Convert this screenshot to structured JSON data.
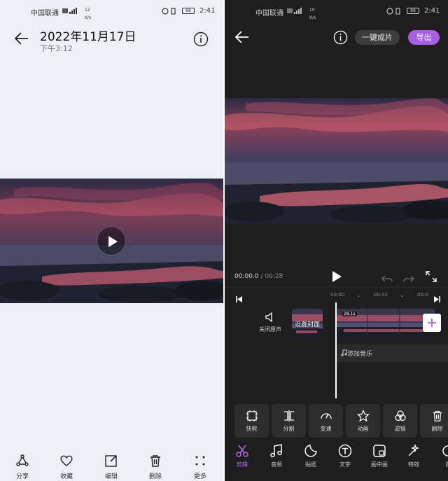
{
  "left": {
    "status_bar": {
      "carrier": "中国联通",
      "speed_value": "12",
      "speed_unit": "K/s",
      "battery": "88",
      "time": "2:41"
    },
    "header": {
      "title": "2022年11月17日",
      "subtitle": "下午3:12"
    },
    "toolbar": [
      {
        "icon": "share-icon",
        "label": "分享"
      },
      {
        "icon": "heart-icon",
        "label": "收藏"
      },
      {
        "icon": "edit-icon",
        "label": "编辑"
      },
      {
        "icon": "trash-icon",
        "label": "删除"
      },
      {
        "icon": "more-icon",
        "label": "更多"
      }
    ]
  },
  "right": {
    "status_bar": {
      "carrier": "中国联通",
      "speed_value": "10",
      "speed_unit": "K/s",
      "battery": "88",
      "time": "2:41"
    },
    "header": {
      "one_click_label": "一键成片",
      "export_label": "导出"
    },
    "player": {
      "current_time": "00:00.0",
      "total_time": "00:28"
    },
    "ruler": {
      "ticks": [
        "00:00",
        "00:02",
        "00:0"
      ]
    },
    "timeline": {
      "mute_label": "关闭原声",
      "cover_label": "设置封面",
      "clip_duration": "28.1s",
      "music_label": "添加音乐"
    },
    "functions": [
      {
        "icon": "quick-cut-icon",
        "label": "快剪"
      },
      {
        "icon": "split-icon",
        "label": "分割"
      },
      {
        "icon": "speed-icon",
        "label": "变速"
      },
      {
        "icon": "animation-icon",
        "label": "动画"
      },
      {
        "icon": "filter-icon",
        "label": "滤镜"
      },
      {
        "icon": "trash-icon",
        "label": "删除"
      }
    ],
    "nav": [
      {
        "icon": "scissors-icon",
        "label": "剪辑",
        "active": true
      },
      {
        "icon": "music-icon",
        "label": "音频",
        "active": false
      },
      {
        "icon": "sticker-icon",
        "label": "贴纸",
        "active": false
      },
      {
        "icon": "text-icon",
        "label": "文字",
        "active": false
      },
      {
        "icon": "pip-icon",
        "label": "画中画",
        "active": false
      },
      {
        "icon": "effects-icon",
        "label": "特效",
        "active": false
      },
      {
        "icon": "adjust-icon",
        "label": "调",
        "active": false
      }
    ],
    "colors": {
      "accent": "#a85ee3",
      "background": "#1e1e1e"
    }
  }
}
